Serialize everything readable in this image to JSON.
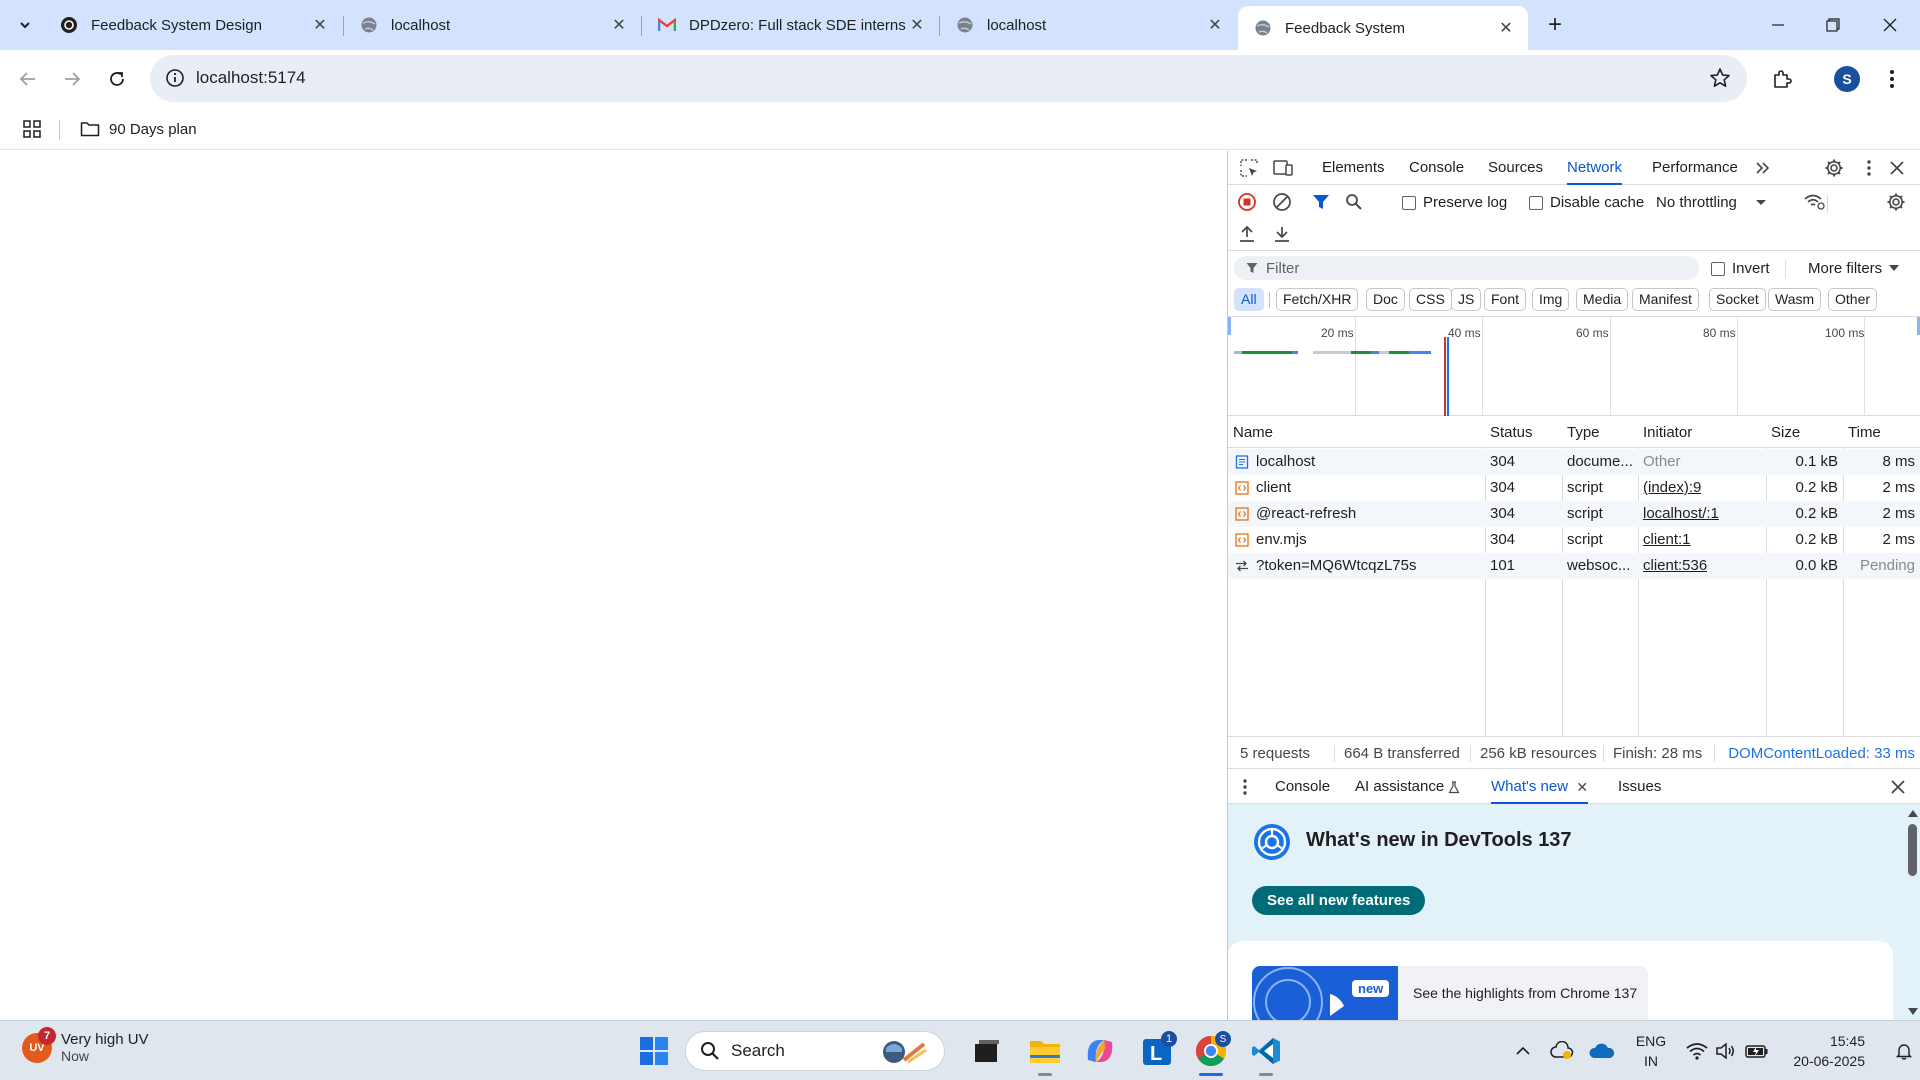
{
  "browser": {
    "tabs": [
      {
        "title": "Feedback System Design",
        "active": false
      },
      {
        "title": "localhost",
        "active": false
      },
      {
        "title": "DPDzero: Full stack SDE interns",
        "active": false
      },
      {
        "title": "localhost",
        "active": false
      },
      {
        "title": "Feedback System",
        "active": true
      }
    ],
    "url": "localhost:5174",
    "profile_initial": "S",
    "bookmarks": [
      {
        "label": "90 Days plan"
      }
    ]
  },
  "devtools": {
    "panels": [
      "Elements",
      "Console",
      "Sources",
      "Network",
      "Performance"
    ],
    "active_panel": "Network",
    "network": {
      "preserve_log_label": "Preserve log",
      "disable_cache_label": "Disable cache",
      "throttling": "No throttling",
      "filter_placeholder": "Filter",
      "invert_label": "Invert",
      "more_filters_label": "More filters",
      "type_filters": [
        "All",
        "Fetch/XHR",
        "Doc",
        "CSS",
        "JS",
        "Font",
        "Img",
        "Media",
        "Manifest",
        "Socket",
        "Wasm",
        "Other"
      ],
      "active_type_filter": "All",
      "timeline_ticks": [
        "20 ms",
        "40 ms",
        "60 ms",
        "80 ms",
        "100 ms"
      ],
      "columns": [
        "Name",
        "Status",
        "Type",
        "Initiator",
        "Size",
        "Time"
      ],
      "rows": [
        {
          "name": "localhost",
          "status": "304",
          "type": "docume...",
          "initiator": "Other",
          "size": "0.1 kB",
          "time": "8 ms",
          "kind": "doc"
        },
        {
          "name": "client",
          "status": "304",
          "type": "script",
          "initiator": "(index):9",
          "size": "0.2 kB",
          "time": "2 ms",
          "kind": "script"
        },
        {
          "name": "@react-refresh",
          "status": "304",
          "type": "script",
          "initiator": "localhost/:1",
          "size": "0.2 kB",
          "time": "2 ms",
          "kind": "script"
        },
        {
          "name": "env.mjs",
          "status": "304",
          "type": "script",
          "initiator": "client:1",
          "size": "0.2 kB",
          "time": "2 ms",
          "kind": "script"
        },
        {
          "name": "?token=MQ6WtcqzL75s",
          "status": "101",
          "type": "websoc...",
          "initiator": "client:536",
          "size": "0.0 kB",
          "time": "Pending",
          "kind": "ws"
        }
      ],
      "summary": {
        "requests": "5 requests",
        "transferred": "664 B transferred",
        "resources": "256 kB resources",
        "finish": "Finish: 28 ms",
        "dcl": "DOMContentLoaded: 33 ms"
      }
    },
    "drawer": {
      "tabs": [
        "Console",
        "AI assistance",
        "What's new",
        "Issues"
      ],
      "active_tab": "What's new",
      "whats_new_title": "What's new in DevTools 137",
      "see_all_label": "See all new features",
      "new_badge": "new",
      "highlights_text": "See the highlights from Chrome 137"
    }
  },
  "taskbar": {
    "weather_title": "Very high UV",
    "weather_sub": "Now",
    "weather_badge": "7",
    "weather_icon_text": "UV",
    "search_label": "Search",
    "language_line1": "ENG",
    "language_line2": "IN",
    "time": "15:45",
    "date": "20-06-2025",
    "app_badges": {
      "linkedin": "1",
      "chrome": "S"
    }
  },
  "colors": {
    "tabstrip": "#d3e3fd",
    "accent": "#0b57d0",
    "whats_new_bg": "#e2f2f8",
    "whats_new_button": "#006c77",
    "record_red": "#d93025"
  }
}
